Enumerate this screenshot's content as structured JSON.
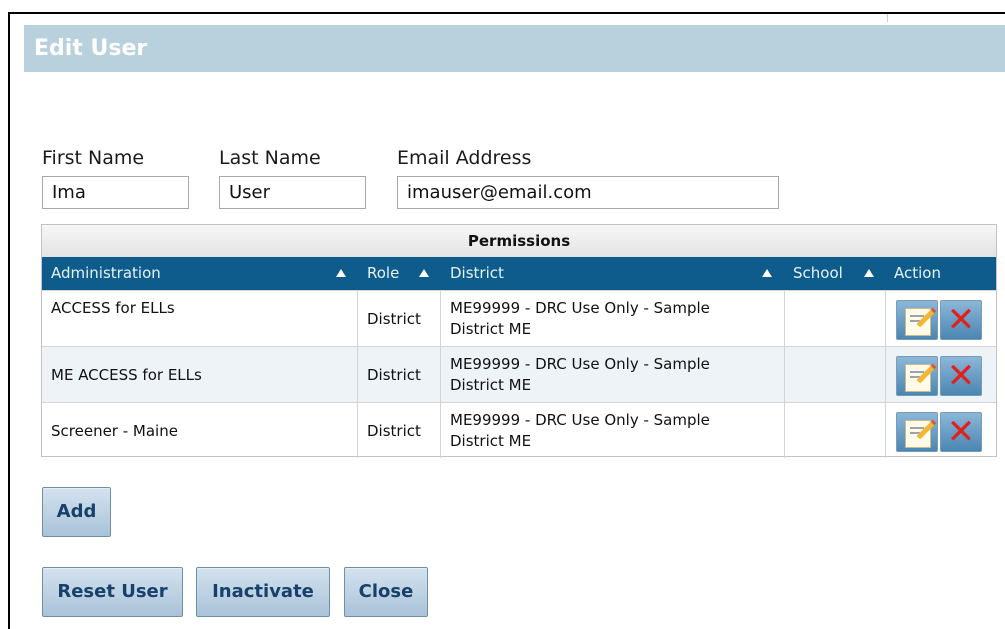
{
  "dialog": {
    "title": "Edit User"
  },
  "form": {
    "first_name": {
      "label": "First Name",
      "value": "Ima"
    },
    "last_name": {
      "label": "Last Name",
      "value": "User"
    },
    "email": {
      "label": "Email Address",
      "value": "imauser@email.com"
    }
  },
  "permissions": {
    "caption": "Permissions",
    "columns": [
      "Administration",
      "Role",
      "District",
      "School",
      "Action"
    ],
    "rows": [
      {
        "administration": "ACCESS for ELLs",
        "role": "District",
        "district_line1": "ME99999 - DRC Use Only - Sample",
        "district_line2": "District ME",
        "school": ""
      },
      {
        "administration": "ME ACCESS for ELLs",
        "role": "District",
        "district_line1": "ME99999 - DRC Use Only - Sample",
        "district_line2": "District ME",
        "school": ""
      },
      {
        "administration": "Screener - Maine",
        "role": "District",
        "district_line1": "ME99999 - DRC Use Only - Sample",
        "district_line2": "District ME",
        "school": ""
      }
    ],
    "row_icons": [
      "edit-icon",
      "delete-icon"
    ],
    "sort_icon": "sort-ascending-icon"
  },
  "buttons": {
    "add": "Add",
    "reset": "Reset User",
    "inactivate": "Inactivate",
    "close": "Close"
  },
  "colors": {
    "header_bg": "#b8d1dc",
    "table_header_bg": "#0e5c8b",
    "button_text": "#17406b",
    "delete_icon": "#e0221c"
  }
}
